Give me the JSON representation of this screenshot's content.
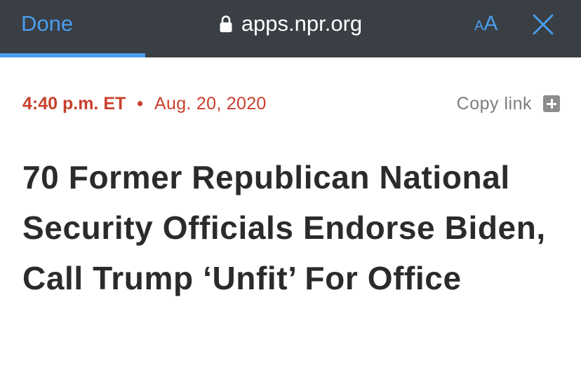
{
  "browser": {
    "done_label": "Done",
    "url": "apps.npr.org",
    "text_size_small": "A",
    "text_size_large": "A",
    "load_progress_percent": 25
  },
  "article": {
    "time": "4:40 p.m. ET",
    "separator": "•",
    "date": "Aug. 20, 2020",
    "copy_link_label": "Copy link",
    "headline": "70 Former Republican National Security Officials Endorse Biden, Call Trump ‘Unfit’ For Office"
  },
  "colors": {
    "toolbar_bg": "#3a3e45",
    "accent_blue": "#4a9eef",
    "meta_red": "#c9402e",
    "headline_text": "#2b2b2b",
    "muted_gray": "#7d7d7d"
  },
  "icons": {
    "lock": "lock-icon",
    "close": "close-icon",
    "copy_link": "plus-icon"
  }
}
